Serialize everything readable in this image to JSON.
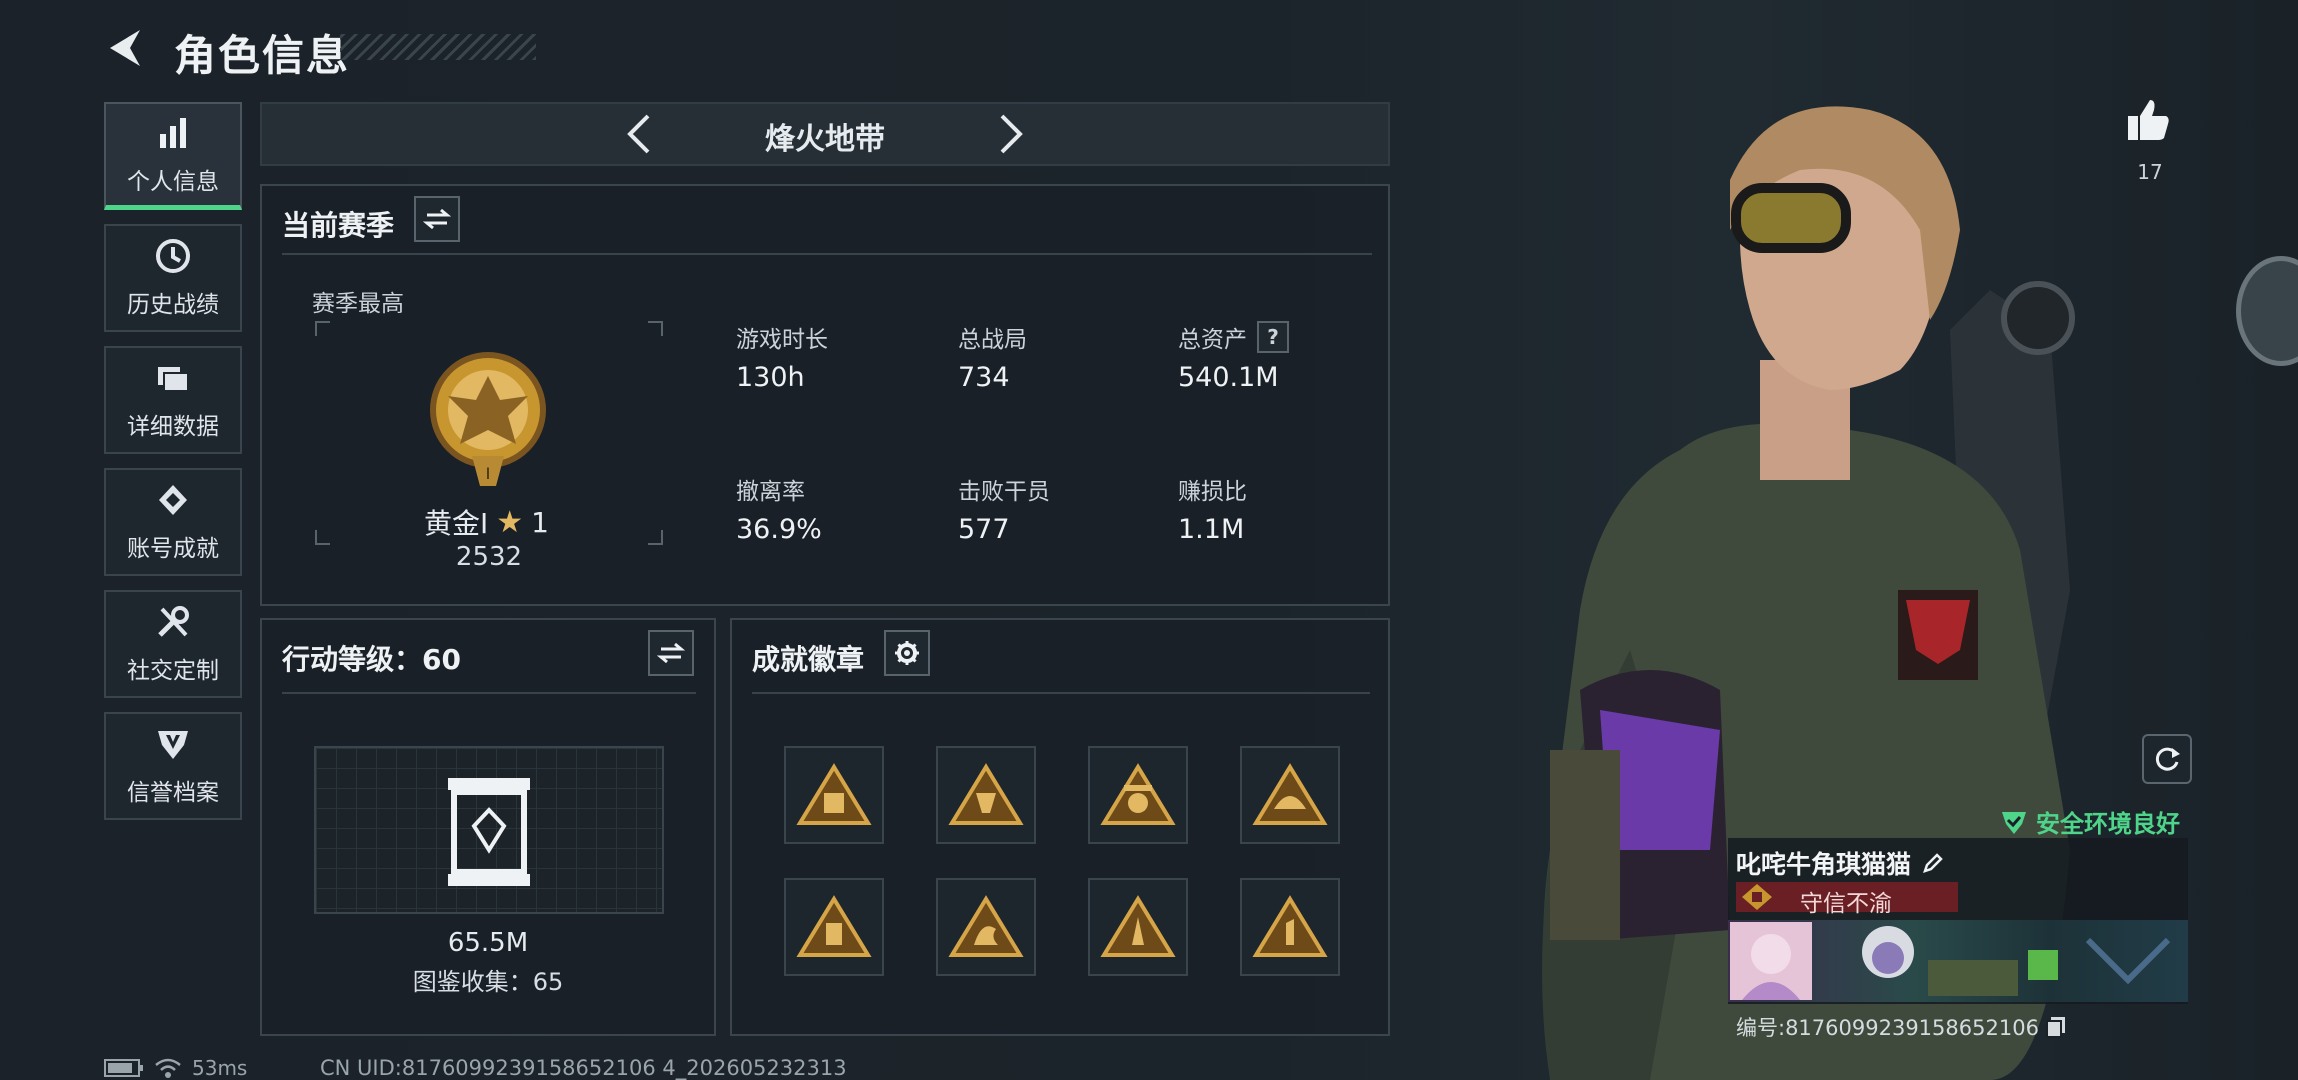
{
  "header": {
    "title": "角色信息"
  },
  "sidebar": {
    "items": [
      {
        "label": "个人信息",
        "icon": "bar-chart-icon",
        "active": true
      },
      {
        "label": "历史战绩",
        "icon": "history-clock-icon"
      },
      {
        "label": "详细数据",
        "icon": "folder-icon"
      },
      {
        "label": "账号成就",
        "icon": "achievement-icon"
      },
      {
        "label": "社交定制",
        "icon": "tools-icon"
      },
      {
        "label": "信誉档案",
        "icon": "shield-v-icon"
      }
    ]
  },
  "mode": {
    "name": "烽火地带"
  },
  "season": {
    "title": "当前赛季",
    "highest_label": "赛季最高",
    "rank_name": "黄金Ⅰ",
    "rank_stars": "1",
    "rank_score": "2532",
    "stats": [
      {
        "label": "游戏时长",
        "value": "130h"
      },
      {
        "label": "总战局",
        "value": "734"
      },
      {
        "label": "总资产",
        "value": "540.1M",
        "help": "?"
      },
      {
        "label": "撤离率",
        "value": "36.9%"
      },
      {
        "label": "击败干员",
        "value": "577"
      },
      {
        "label": "赚损比",
        "value": "1.1M"
      }
    ]
  },
  "action_level": {
    "title": "行动等级：60",
    "value": "65.5M",
    "collection_label": "图鉴收集：65"
  },
  "achievements": {
    "title": "成就徽章",
    "badges": [
      "badge-icon",
      "badge-icon",
      "badge-icon",
      "badge-icon",
      "badge-icon",
      "badge-icon",
      "badge-icon",
      "badge-icon"
    ]
  },
  "profile": {
    "likes": "17",
    "safe_status": "安全环境良好",
    "player_name": "叱咤牛角琪猫猫",
    "title": "守信不渝",
    "player_id": "编号:8176099239158652106"
  },
  "footer": {
    "ping": "53ms",
    "uid": "CN UID:8176099239158652106 4_202605232313"
  },
  "colors": {
    "accent_green": "#4fd58a",
    "title_red": "#6a1f24",
    "gold": "#c8962e"
  }
}
